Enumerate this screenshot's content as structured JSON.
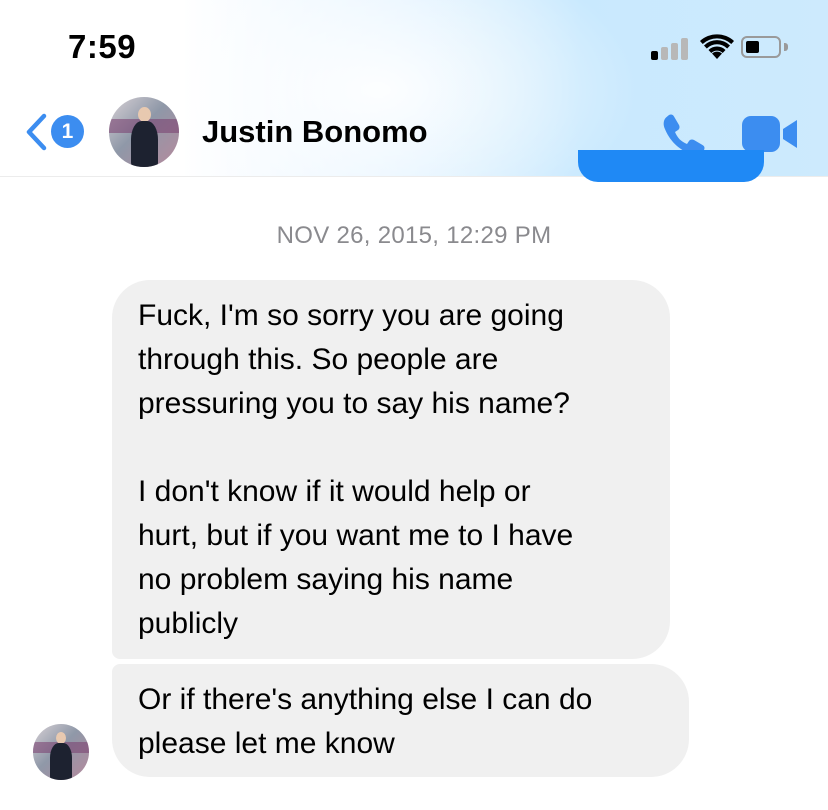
{
  "status_bar": {
    "time": "7:59",
    "signal_icon": "cellular-signal-icon",
    "wifi_icon": "wifi-icon",
    "battery_icon": "battery-icon"
  },
  "header": {
    "back_icon": "chevron-left-icon",
    "unread_badge": "1",
    "contact_name": "Justin Bonomo",
    "call_icon": "phone-icon",
    "video_icon": "video-camera-icon",
    "accent_color": "#3c8df0"
  },
  "conversation": {
    "timestamp": "NOV 26, 2015, 12:29 PM",
    "messages": [
      {
        "text": "Fuck, I'm so sorry you are going\nthrough this. So people are\npressuring you to say his name?\n\nI don't know if it would help or\nhurt, but if you want me to I have\nno problem saying his name\npublicly"
      },
      {
        "text": "Or if there's anything else I can do\nplease let me know"
      }
    ],
    "bubble_color": "#f0f0f0"
  }
}
